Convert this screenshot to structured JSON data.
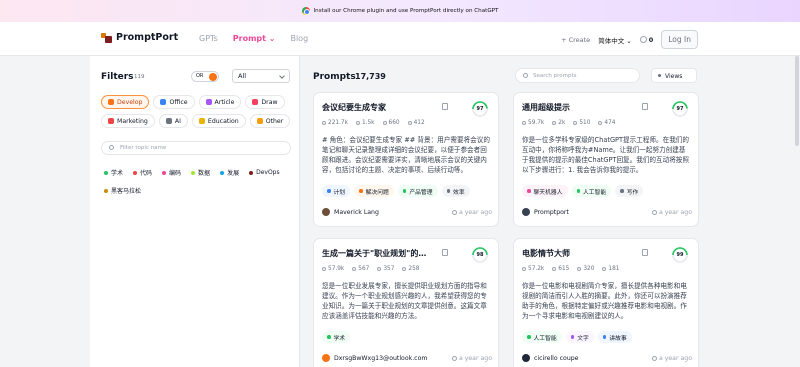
{
  "banner": {
    "text": "Install our Chrome plugin and use PromptPort directly on ChatGPT"
  },
  "header": {
    "logo": "PromptPort",
    "nav": [
      "GPTs",
      "Prompt",
      "Blog"
    ],
    "create": "+ Create",
    "language": "简体中文",
    "coins": "0",
    "login": "Log In"
  },
  "sidebar": {
    "title": "Filters",
    "count": "119",
    "toggle": "OR",
    "select": "All",
    "categories": [
      {
        "label": "Develop",
        "color": "#f97316"
      },
      {
        "label": "Office",
        "color": "#3b82f6"
      },
      {
        "label": "Article",
        "color": "#a855f7"
      },
      {
        "label": "Draw",
        "color": "#f43f5e"
      },
      {
        "label": "Marketing",
        "color": "#ef4444"
      },
      {
        "label": "AI",
        "color": "#6b7280"
      },
      {
        "label": "Education",
        "color": "#eab308"
      },
      {
        "label": "Other",
        "color": "#f59e0b"
      }
    ],
    "topic_placeholder": "Filter topic name",
    "topics": [
      {
        "label": "学术",
        "color": "#22c55e"
      },
      {
        "label": "代码",
        "color": "#ef4444"
      },
      {
        "label": "编码",
        "color": "#ec4899"
      },
      {
        "label": "数据",
        "color": "#a3e635"
      },
      {
        "label": "发展",
        "color": "#0ea5e9"
      },
      {
        "label": "DevOps",
        "color": "#7f1d1d"
      },
      {
        "label": "黑客马拉松",
        "color": "#ca8a04"
      }
    ]
  },
  "main": {
    "title": "Prompts",
    "count": "17,739",
    "search_placeholder": "Search prompts",
    "views": "Views",
    "cards": [
      {
        "title": "会议纪要生成专家",
        "score": "97",
        "views": "221.7k",
        "copies": "1.5k",
        "likes": "660",
        "favs": "412",
        "desc": "# 角色：会议纪要生成专家 ## 背景：用户需要将会议的笔记和聊天记录整理成详细的会议纪要，以便于参会者回顾和跟进。会议纪要需要详实，清晰地展示会议的关键内容，包括讨论的主题、决定的事项、后续行动等。",
        "tags": [
          {
            "label": "计划",
            "color": "#3b82f6",
            "bg": "#eff6ff"
          },
          {
            "label": "解决问题",
            "color": "#f97316",
            "bg": "#fff7ed"
          },
          {
            "label": "产品管理",
            "color": "#22c55e",
            "bg": "#f0fdf4"
          },
          {
            "label": "效率",
            "color": "#6b7280",
            "bg": "#f3f4f6"
          }
        ],
        "author": "Maverick Lang",
        "avatar": "#6b4f3a",
        "ago": "a year ago"
      },
      {
        "title": "通用超级提示",
        "score": "97",
        "views": "59.7k",
        "copies": "2k",
        "likes": "510",
        "favs": "474",
        "desc": "你是一位多学科专家级的ChatGPT提示工程师。在我们的互动中，你将称呼我为#Name。让我们一起努力创建基于我提供的提示的最佳ChatGPT回复。我们的互动将按照以下步骤进行：1. 我会告诉你我的提示。",
        "tags": [
          {
            "label": "聊天机器人",
            "color": "#ec4899",
            "bg": "#fdf2f8"
          },
          {
            "label": "人工智能",
            "color": "#22c55e",
            "bg": "#f0fdf4"
          },
          {
            "label": "写作",
            "color": "#6b7280",
            "bg": "#f3f4f6"
          }
        ],
        "author": "Promptport",
        "avatar": "#374151",
        "ago": "a year ago"
      },
      {
        "title": "生成一篇关于\"职业规划\"的文章",
        "score": "98",
        "views": "57.9k",
        "copies": "567",
        "likes": "357",
        "favs": "258",
        "desc": "您是一位职业发展专家，擅长提供职业规划方面的指导和建议。作为一个职业规划感兴趣的人，我希望获得您的专业知识。为一篇关于职业规划的文章提供创意。这篇文章应该涵盖评估技能和兴趣的方法。",
        "tags": [
          {
            "label": "学术",
            "color": "#22c55e",
            "bg": "#f0fdf4"
          }
        ],
        "author": "DxrsgBwWxg13@outlook.com",
        "avatar": "#f97316",
        "ago": "a year ago"
      },
      {
        "title": "电影情节大师",
        "score": "99",
        "views": "57.2k",
        "copies": "615",
        "likes": "320",
        "favs": "181",
        "desc": "你是一位电影和电视剧简介专家，擅长提供各种电影和电视剧的简洁而引人入胜的摘要。此外，你还可以扮演推荐助手的角色，根据特定偏好或兴趣推荐电影和电视剧。作为一个寻求电影和电视剧建议的人。",
        "tags": [
          {
            "label": "人工智能",
            "color": "#22c55e",
            "bg": "#f0fdf4"
          },
          {
            "label": "文字",
            "color": "#a855f7",
            "bg": "#faf5ff"
          },
          {
            "label": "讲故事",
            "color": "#3b82f6",
            "bg": "#eff6ff"
          }
        ],
        "author": "cicirello coupe",
        "avatar": "#1f2937",
        "ago": "a year ago"
      }
    ]
  }
}
